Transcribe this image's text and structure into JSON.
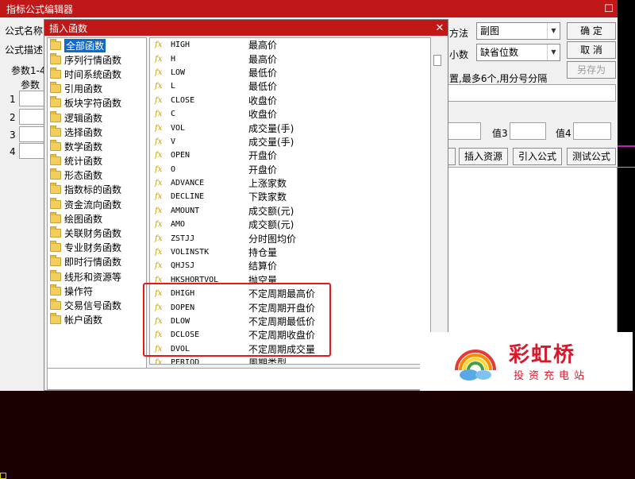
{
  "editor": {
    "title": "指标公式编辑器",
    "labels": {
      "formula_name": "公式名称",
      "formula_desc": "公式描述",
      "params": "参数1-4",
      "param_col": "参数",
      "row1": "1",
      "row2": "2",
      "row3": "3",
      "row4": "4",
      "method": "方法",
      "decimals": "小数",
      "hint": "置,最多6个,用分号分隔",
      "val3": "值3",
      "val4": "值4"
    },
    "method_value": "副图",
    "decimals_value": "缺省位数",
    "buttons": {
      "ok": "确  定",
      "cancel": "取  消",
      "save_as": "另存为",
      "insert_resource": "插入资源",
      "import_formula": "引入公式",
      "test_formula": "测试公式"
    }
  },
  "dialog": {
    "title": "插入函数",
    "close": "✕",
    "categories": [
      "全部函数",
      "序列行情函数",
      "时间系统函数",
      "引用函数",
      "板块字符函数",
      "逻辑函数",
      "选择函数",
      "数学函数",
      "统计函数",
      "形态函数",
      "指数标的函数",
      "资金流向函数",
      "绘图函数",
      "关联财务函数",
      "专业财务函数",
      "即时行情函数",
      "线形和资源等",
      "操作符",
      "交易信号函数",
      "帐户函数"
    ],
    "selected_category": "全部函数",
    "functions": [
      {
        "name": "HIGH",
        "desc": "最高价"
      },
      {
        "name": "H",
        "desc": "最高价"
      },
      {
        "name": "LOW",
        "desc": "最低价"
      },
      {
        "name": "L",
        "desc": "最低价"
      },
      {
        "name": "CLOSE",
        "desc": "收盘价"
      },
      {
        "name": "C",
        "desc": "收盘价"
      },
      {
        "name": "VOL",
        "desc": "成交量(手)"
      },
      {
        "name": "V",
        "desc": "成交量(手)"
      },
      {
        "name": "OPEN",
        "desc": "开盘价"
      },
      {
        "name": "O",
        "desc": "开盘价"
      },
      {
        "name": "ADVANCE",
        "desc": "上涨家数"
      },
      {
        "name": "DECLINE",
        "desc": "下跌家数"
      },
      {
        "name": "AMOUNT",
        "desc": "成交额(元)"
      },
      {
        "name": "AMO",
        "desc": "成交额(元)"
      },
      {
        "name": "ZSTJJ",
        "desc": "分时图均价"
      },
      {
        "name": "VOLINSTK",
        "desc": "持仓量"
      },
      {
        "name": "QHJSJ",
        "desc": "结算价"
      },
      {
        "name": "HKSHORTVOL",
        "desc": "抛空量"
      },
      {
        "name": "DHIGH",
        "desc": "不定周期最高价"
      },
      {
        "name": "DOPEN",
        "desc": "不定周期开盘价"
      },
      {
        "name": "DLOW",
        "desc": "不定周期最低价"
      },
      {
        "name": "DCLOSE",
        "desc": "不定周期收盘价"
      },
      {
        "name": "DVOL",
        "desc": "不定周期成交量"
      },
      {
        "name": "PERIOD",
        "desc": "周期类型"
      }
    ],
    "fx_glyph": "fx"
  },
  "watermark": {
    "brand": "彩虹桥",
    "tagline": "投资充电站"
  },
  "colors": {
    "titlebar": "#c01818",
    "highlight": "#e81818",
    "selection": "#0a6ad0",
    "brand": "#d9182b"
  }
}
